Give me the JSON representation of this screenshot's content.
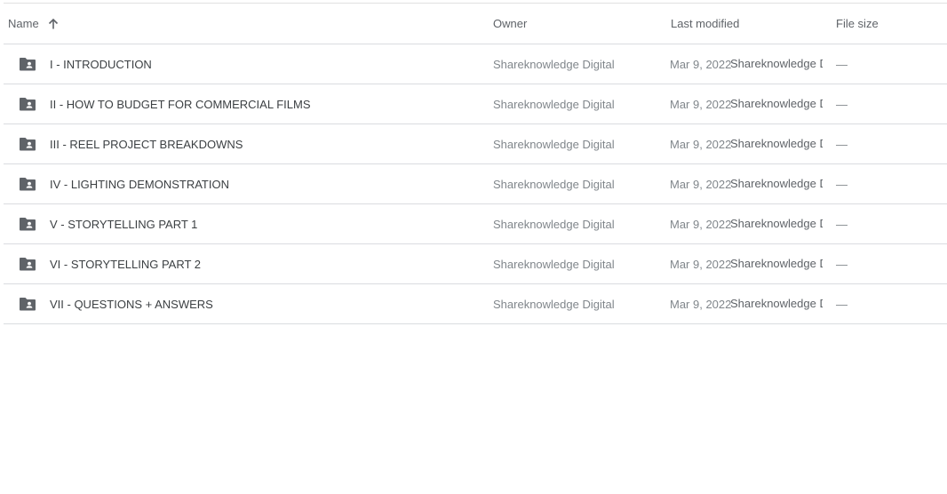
{
  "columns": {
    "name": "Name",
    "owner": "Owner",
    "last_modified": "Last modified",
    "file_size": "File size",
    "sort_icon": "arrow-up-icon"
  },
  "rows": [
    {
      "icon": "shared-folder-icon",
      "name": "I - INTRODUCTION",
      "owner": "Shareknowledge Digital",
      "date": "Mar 9, 2022",
      "modified_by": "Shareknowledge Digital",
      "size": "—"
    },
    {
      "icon": "shared-folder-icon",
      "name": "II - HOW TO BUDGET FOR COMMERCIAL FILMS",
      "owner": "Shareknowledge Digital",
      "date": "Mar 9, 2022",
      "modified_by": "Shareknowledge Digital",
      "size": "—"
    },
    {
      "icon": "shared-folder-icon",
      "name": "III - REEL PROJECT BREAKDOWNS",
      "owner": "Shareknowledge Digital",
      "date": "Mar 9, 2022",
      "modified_by": "Shareknowledge Digital",
      "size": "—"
    },
    {
      "icon": "shared-folder-icon",
      "name": "IV - LIGHTING DEMONSTRATION",
      "owner": "Shareknowledge Digital",
      "date": "Mar 9, 2022",
      "modified_by": "Shareknowledge Digital",
      "size": "—"
    },
    {
      "icon": "shared-folder-icon",
      "name": "V - STORYTELLING PART 1",
      "owner": "Shareknowledge Digital",
      "date": "Mar 9, 2022",
      "modified_by": "Shareknowledge Digital",
      "size": "—"
    },
    {
      "icon": "shared-folder-icon",
      "name": "VI - STORYTELLING PART 2",
      "owner": "Shareknowledge Digital",
      "date": "Mar 9, 2022",
      "modified_by": "Shareknowledge Digital",
      "size": "—"
    },
    {
      "icon": "shared-folder-icon",
      "name": "VII - QUESTIONS + ANSWERS",
      "owner": "Shareknowledge Digital",
      "date": "Mar 9, 2022",
      "modified_by": "Shareknowledge Digital",
      "size": "—"
    }
  ]
}
